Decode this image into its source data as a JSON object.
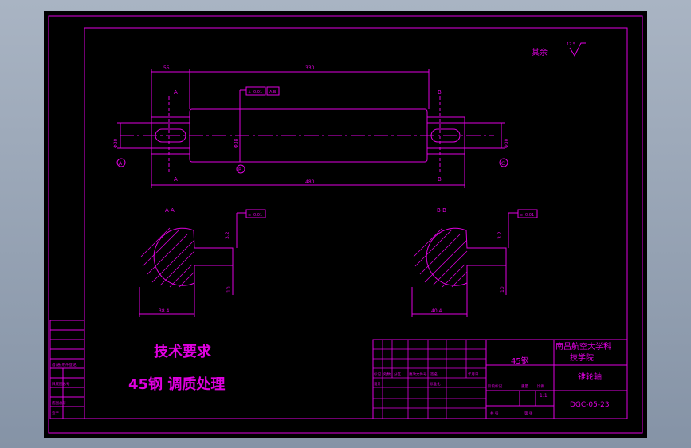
{
  "colors": {
    "background": "#000000",
    "line": "#e000e0",
    "outer_frame": "#9aa6b8"
  },
  "surface_finish": {
    "label": "其余",
    "symbol_value": "12.5"
  },
  "view_main": {
    "dim_left_length": "55",
    "dim_mid_length": "330",
    "dim_total_length": "480",
    "section_label_a": "A",
    "section_label_b": "B",
    "left_diameter": "Φ30",
    "middle_diameter": "Φ38",
    "right_diameter": "Φ30",
    "datum_left": "A",
    "datum_mid": "B",
    "datum_right": "C",
    "tolerance_frame": [
      "⊥",
      "0.01",
      "A-B"
    ]
  },
  "section_a": {
    "title": "A-A",
    "dim_bottom": "38.4",
    "dim_depth": "10",
    "dim_width": "3.2",
    "tolerance_frame": [
      "≡",
      "0.01"
    ]
  },
  "section_b": {
    "title": "B-B",
    "dim_bottom": "40.4",
    "dim_depth": "10",
    "dim_width": "3.2",
    "tolerance_frame": [
      "≡",
      "0.01"
    ]
  },
  "technical_requirements": {
    "title": "技术要求",
    "line1": "45钢 调质处理"
  },
  "title_block": {
    "material": "45钢",
    "school_line1": "南昌航空大学科",
    "school_line2": "技学院",
    "part_name": "锥轮轴",
    "drawing_number": "DGC-05-23",
    "scale": "1:1",
    "mark_label": "标记",
    "count_label": "处数",
    "zone_label": "分区",
    "change_label": "更改文件号",
    "sign_label": "签名",
    "date_label": "年月日",
    "design_label": "设计",
    "standard_label": "标准化",
    "stage_label": "阶段标记",
    "weight_label": "重量",
    "scale_label": "比例",
    "sheet_total_label": "共 张",
    "sheet_label": "第 张"
  },
  "left_strip": {
    "label1": "借(通)用件登记",
    "label2": "旧底图总号",
    "label3": "底图总号",
    "label4": "签字"
  }
}
